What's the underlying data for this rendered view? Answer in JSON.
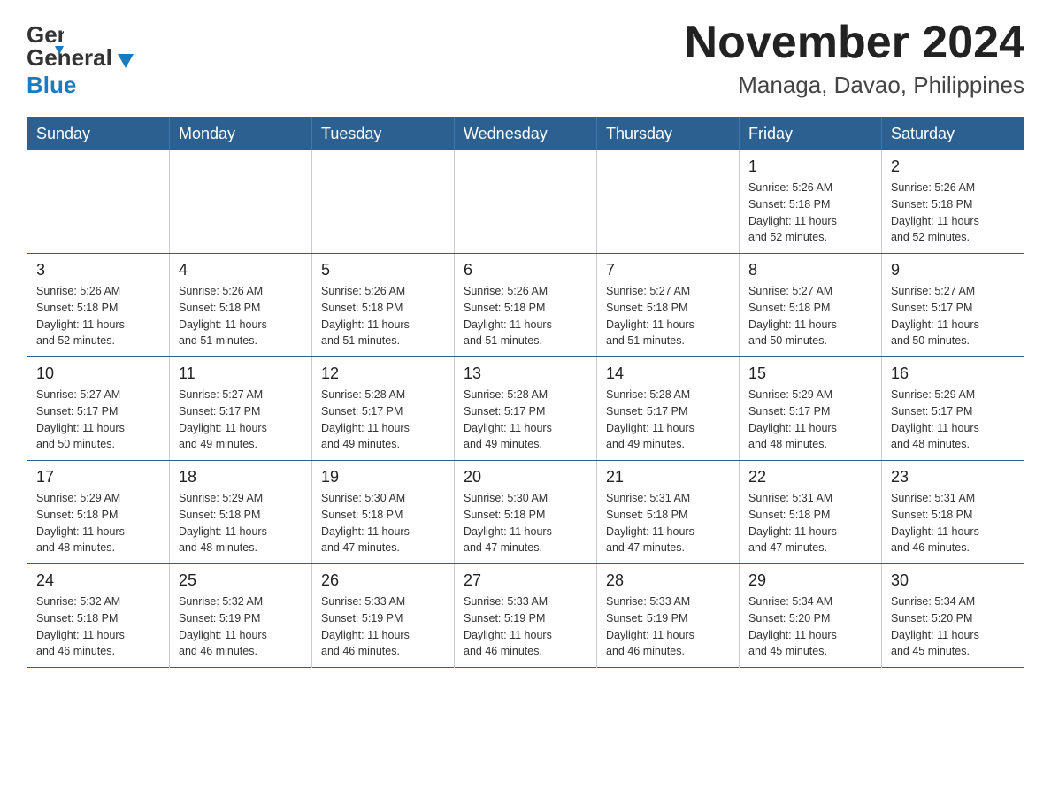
{
  "header": {
    "logo_line1": "General",
    "logo_line2": "Blue",
    "month_title": "November 2024",
    "location": "Managa, Davao, Philippines"
  },
  "calendar": {
    "days_of_week": [
      "Sunday",
      "Monday",
      "Tuesday",
      "Wednesday",
      "Thursday",
      "Friday",
      "Saturday"
    ],
    "weeks": [
      [
        {
          "day": "",
          "info": ""
        },
        {
          "day": "",
          "info": ""
        },
        {
          "day": "",
          "info": ""
        },
        {
          "day": "",
          "info": ""
        },
        {
          "day": "",
          "info": ""
        },
        {
          "day": "1",
          "info": "Sunrise: 5:26 AM\nSunset: 5:18 PM\nDaylight: 11 hours\nand 52 minutes."
        },
        {
          "day": "2",
          "info": "Sunrise: 5:26 AM\nSunset: 5:18 PM\nDaylight: 11 hours\nand 52 minutes."
        }
      ],
      [
        {
          "day": "3",
          "info": "Sunrise: 5:26 AM\nSunset: 5:18 PM\nDaylight: 11 hours\nand 52 minutes."
        },
        {
          "day": "4",
          "info": "Sunrise: 5:26 AM\nSunset: 5:18 PM\nDaylight: 11 hours\nand 51 minutes."
        },
        {
          "day": "5",
          "info": "Sunrise: 5:26 AM\nSunset: 5:18 PM\nDaylight: 11 hours\nand 51 minutes."
        },
        {
          "day": "6",
          "info": "Sunrise: 5:26 AM\nSunset: 5:18 PM\nDaylight: 11 hours\nand 51 minutes."
        },
        {
          "day": "7",
          "info": "Sunrise: 5:27 AM\nSunset: 5:18 PM\nDaylight: 11 hours\nand 51 minutes."
        },
        {
          "day": "8",
          "info": "Sunrise: 5:27 AM\nSunset: 5:18 PM\nDaylight: 11 hours\nand 50 minutes."
        },
        {
          "day": "9",
          "info": "Sunrise: 5:27 AM\nSunset: 5:17 PM\nDaylight: 11 hours\nand 50 minutes."
        }
      ],
      [
        {
          "day": "10",
          "info": "Sunrise: 5:27 AM\nSunset: 5:17 PM\nDaylight: 11 hours\nand 50 minutes."
        },
        {
          "day": "11",
          "info": "Sunrise: 5:27 AM\nSunset: 5:17 PM\nDaylight: 11 hours\nand 49 minutes."
        },
        {
          "day": "12",
          "info": "Sunrise: 5:28 AM\nSunset: 5:17 PM\nDaylight: 11 hours\nand 49 minutes."
        },
        {
          "day": "13",
          "info": "Sunrise: 5:28 AM\nSunset: 5:17 PM\nDaylight: 11 hours\nand 49 minutes."
        },
        {
          "day": "14",
          "info": "Sunrise: 5:28 AM\nSunset: 5:17 PM\nDaylight: 11 hours\nand 49 minutes."
        },
        {
          "day": "15",
          "info": "Sunrise: 5:29 AM\nSunset: 5:17 PM\nDaylight: 11 hours\nand 48 minutes."
        },
        {
          "day": "16",
          "info": "Sunrise: 5:29 AM\nSunset: 5:17 PM\nDaylight: 11 hours\nand 48 minutes."
        }
      ],
      [
        {
          "day": "17",
          "info": "Sunrise: 5:29 AM\nSunset: 5:18 PM\nDaylight: 11 hours\nand 48 minutes."
        },
        {
          "day": "18",
          "info": "Sunrise: 5:29 AM\nSunset: 5:18 PM\nDaylight: 11 hours\nand 48 minutes."
        },
        {
          "day": "19",
          "info": "Sunrise: 5:30 AM\nSunset: 5:18 PM\nDaylight: 11 hours\nand 47 minutes."
        },
        {
          "day": "20",
          "info": "Sunrise: 5:30 AM\nSunset: 5:18 PM\nDaylight: 11 hours\nand 47 minutes."
        },
        {
          "day": "21",
          "info": "Sunrise: 5:31 AM\nSunset: 5:18 PM\nDaylight: 11 hours\nand 47 minutes."
        },
        {
          "day": "22",
          "info": "Sunrise: 5:31 AM\nSunset: 5:18 PM\nDaylight: 11 hours\nand 47 minutes."
        },
        {
          "day": "23",
          "info": "Sunrise: 5:31 AM\nSunset: 5:18 PM\nDaylight: 11 hours\nand 46 minutes."
        }
      ],
      [
        {
          "day": "24",
          "info": "Sunrise: 5:32 AM\nSunset: 5:18 PM\nDaylight: 11 hours\nand 46 minutes."
        },
        {
          "day": "25",
          "info": "Sunrise: 5:32 AM\nSunset: 5:19 PM\nDaylight: 11 hours\nand 46 minutes."
        },
        {
          "day": "26",
          "info": "Sunrise: 5:33 AM\nSunset: 5:19 PM\nDaylight: 11 hours\nand 46 minutes."
        },
        {
          "day": "27",
          "info": "Sunrise: 5:33 AM\nSunset: 5:19 PM\nDaylight: 11 hours\nand 46 minutes."
        },
        {
          "day": "28",
          "info": "Sunrise: 5:33 AM\nSunset: 5:19 PM\nDaylight: 11 hours\nand 46 minutes."
        },
        {
          "day": "29",
          "info": "Sunrise: 5:34 AM\nSunset: 5:20 PM\nDaylight: 11 hours\nand 45 minutes."
        },
        {
          "day": "30",
          "info": "Sunrise: 5:34 AM\nSunset: 5:20 PM\nDaylight: 11 hours\nand 45 minutes."
        }
      ]
    ]
  }
}
